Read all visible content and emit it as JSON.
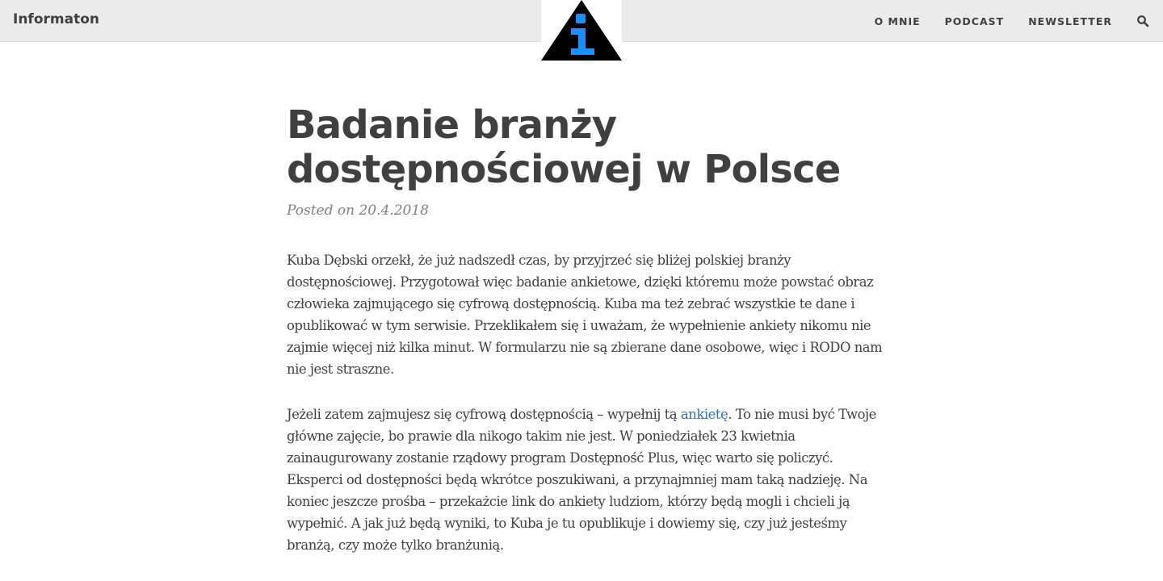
{
  "site": {
    "brand": "Informaton",
    "nav": {
      "about": "O MNIE",
      "podcast": "PODCAST",
      "newsletter": "NEWSLETTER"
    },
    "logo_icon": "info-triangle-icon",
    "search_icon": "search-icon"
  },
  "post": {
    "title": "Badanie branży dostępnościowej w Polsce",
    "meta": "Posted on 20.4.2018",
    "p1": "Kuba Dębski orzekł, że już nadszedł czas, by przyjrzeć się bliżej polskiej branży dostępnościowej. Przygotował więc badanie ankietowe, dzięki któremu może powstać obraz człowieka zajmującego się cyfrową dostępnością. Kuba ma też zebrać wszystkie te dane i opublikować w tym serwisie. Przeklikałem się i uważam, że wypełnienie ankiety nikomu nie zajmie więcej niż kilka minut. W formularzu nie są zbierane dane osobowe, więc i RODO nam nie jest straszne.",
    "p2_before": "Jeżeli zatem zajmujesz się cyfrową dostępnością – wypełnij tą ",
    "p2_link": "ankietę",
    "p2_after": ". To nie musi być Twoje główne zajęcie, bo prawie dla nikogo takim nie jest. W poniedziałek 23 kwietnia zainaugurowany zostanie rządowy program Dostępność Plus, więc warto się policzyć. Eksperci od dostępności będą wkrótce poszukiwani, a przynajmniej mam taką nadzieję. Na koniec jeszcze prośba – przekażcie link do ankiety ludziom, którzy będą mogli i chcieli ją wypełnić. A jak już będą wyniki, to Kuba je tu opublikuje i dowiemy się, czy już jesteśmy branżą, czy może tylko branżunią."
  },
  "colors": {
    "navbar_bg": "#ebebeb",
    "text": "#404040",
    "meta": "#808080",
    "link": "#2f6fc0",
    "logo_accent": "#1a8fff"
  }
}
